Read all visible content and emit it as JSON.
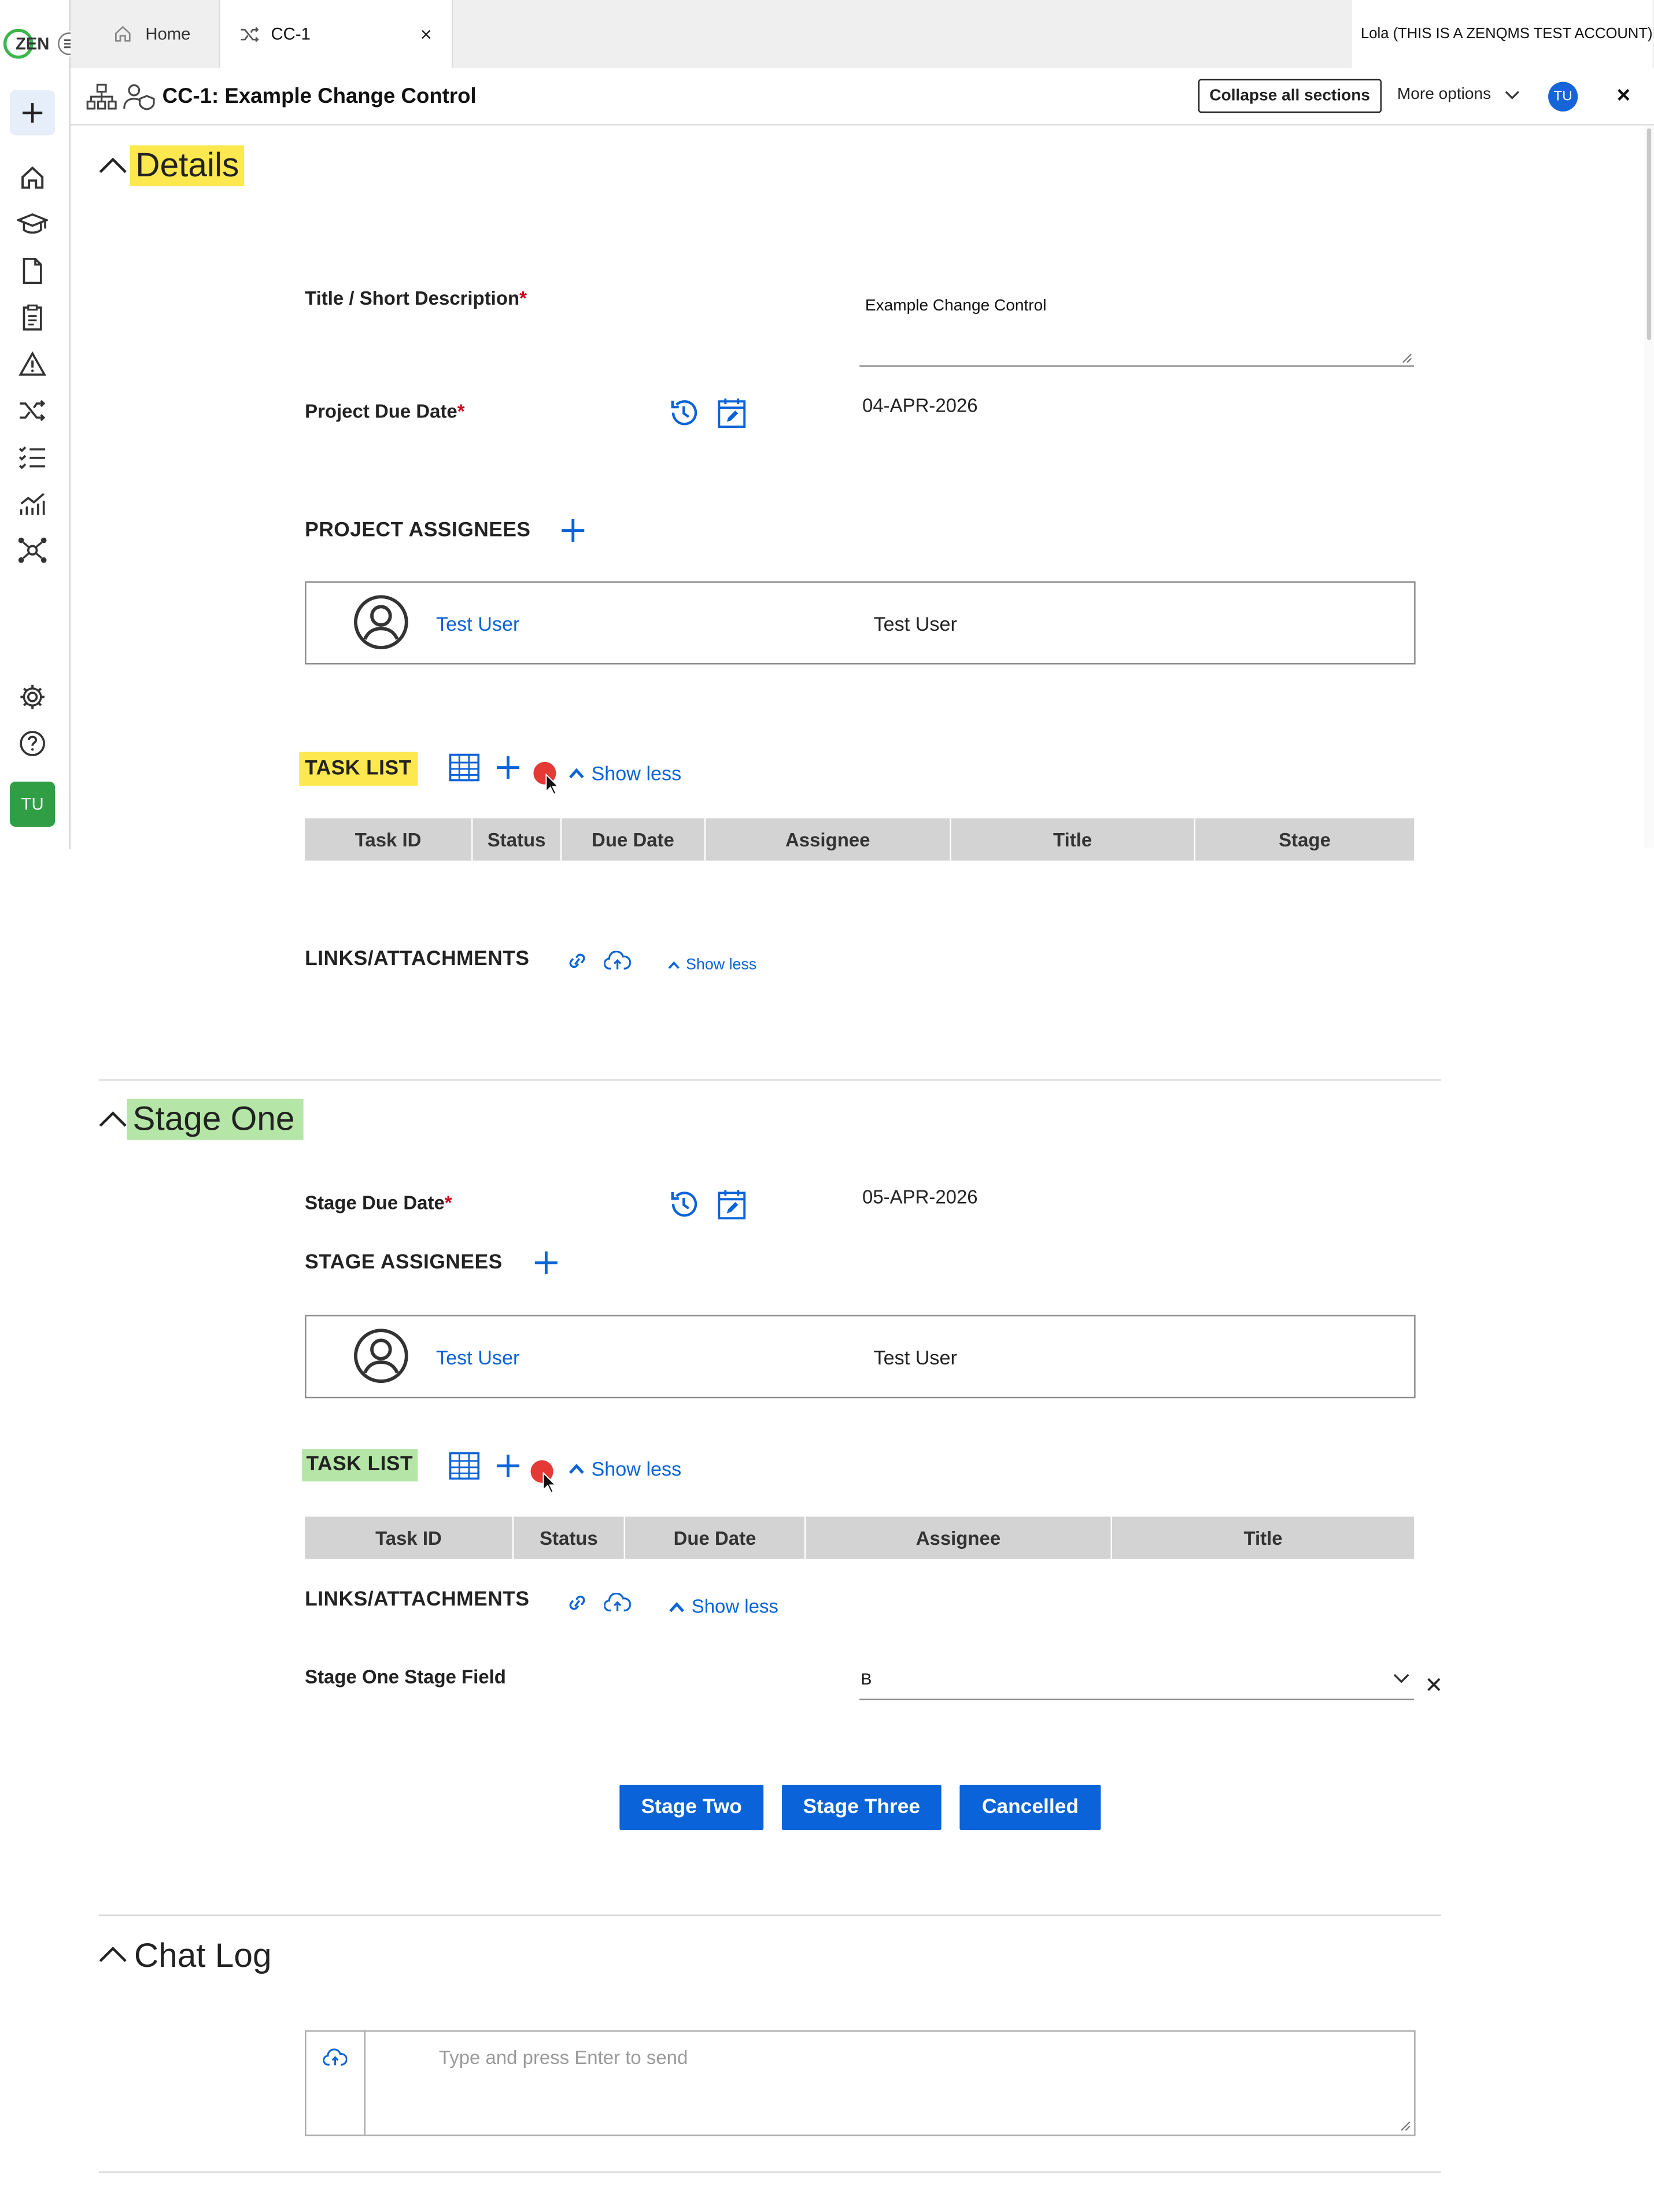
{
  "tabs": [
    {
      "label": "Home"
    },
    {
      "label": "CC-1",
      "close": "×"
    }
  ],
  "account": "Lola (THIS IS A ZENQMS TEST ACCOUNT)",
  "sidebar": {
    "logo": "ZEN",
    "avatar": "TU"
  },
  "header": {
    "title": "CC-1: Example Change Control",
    "collapse_button": "Collapse all sections",
    "more_options": "More options",
    "avatar": "TU",
    "close": "✕"
  },
  "details": {
    "section_title": "Details",
    "title_label": "Title / Short Description",
    "title_value": "Example Change Control",
    "due_label": "Project Due Date",
    "due_value": "04-APR-2026",
    "assignees_label": "PROJECT ASSIGNEES",
    "assignee_link": "Test User",
    "assignee_name": "Test User",
    "task_list_label": "TASK LIST",
    "show_less": "Show less",
    "task_columns": [
      "Task ID",
      "Status",
      "Due Date",
      "Assignee",
      "Title",
      "Stage"
    ],
    "links_label": "LINKS/ATTACHMENTS",
    "links_show_less": "Show less"
  },
  "stage_one": {
    "section_title": "Stage One",
    "due_label": "Stage Due Date",
    "due_value": "05-APR-2026",
    "assignees_label": "STAGE ASSIGNEES",
    "assignee_link": "Test User",
    "assignee_name": "Test User",
    "task_list_label": "TASK LIST",
    "show_less": "Show less",
    "task_columns": [
      "Task ID",
      "Status",
      "Due Date",
      "Assignee",
      "Title"
    ],
    "links_label": "LINKS/ATTACHMENTS",
    "links_show_less": "Show less",
    "field_label": "Stage One Stage Field",
    "field_value": "B",
    "transitions": [
      "Stage Two",
      "Stage Three",
      "Cancelled"
    ]
  },
  "chat_log": {
    "section_title": "Chat Log",
    "placeholder": "Type and press Enter to send"
  },
  "colors": {
    "accent": "#0a63d8",
    "details_highlight": "#fde84f",
    "stage_highlight": "#b5e6a7",
    "record_dot": "#e53935",
    "required": "#d0021b"
  }
}
